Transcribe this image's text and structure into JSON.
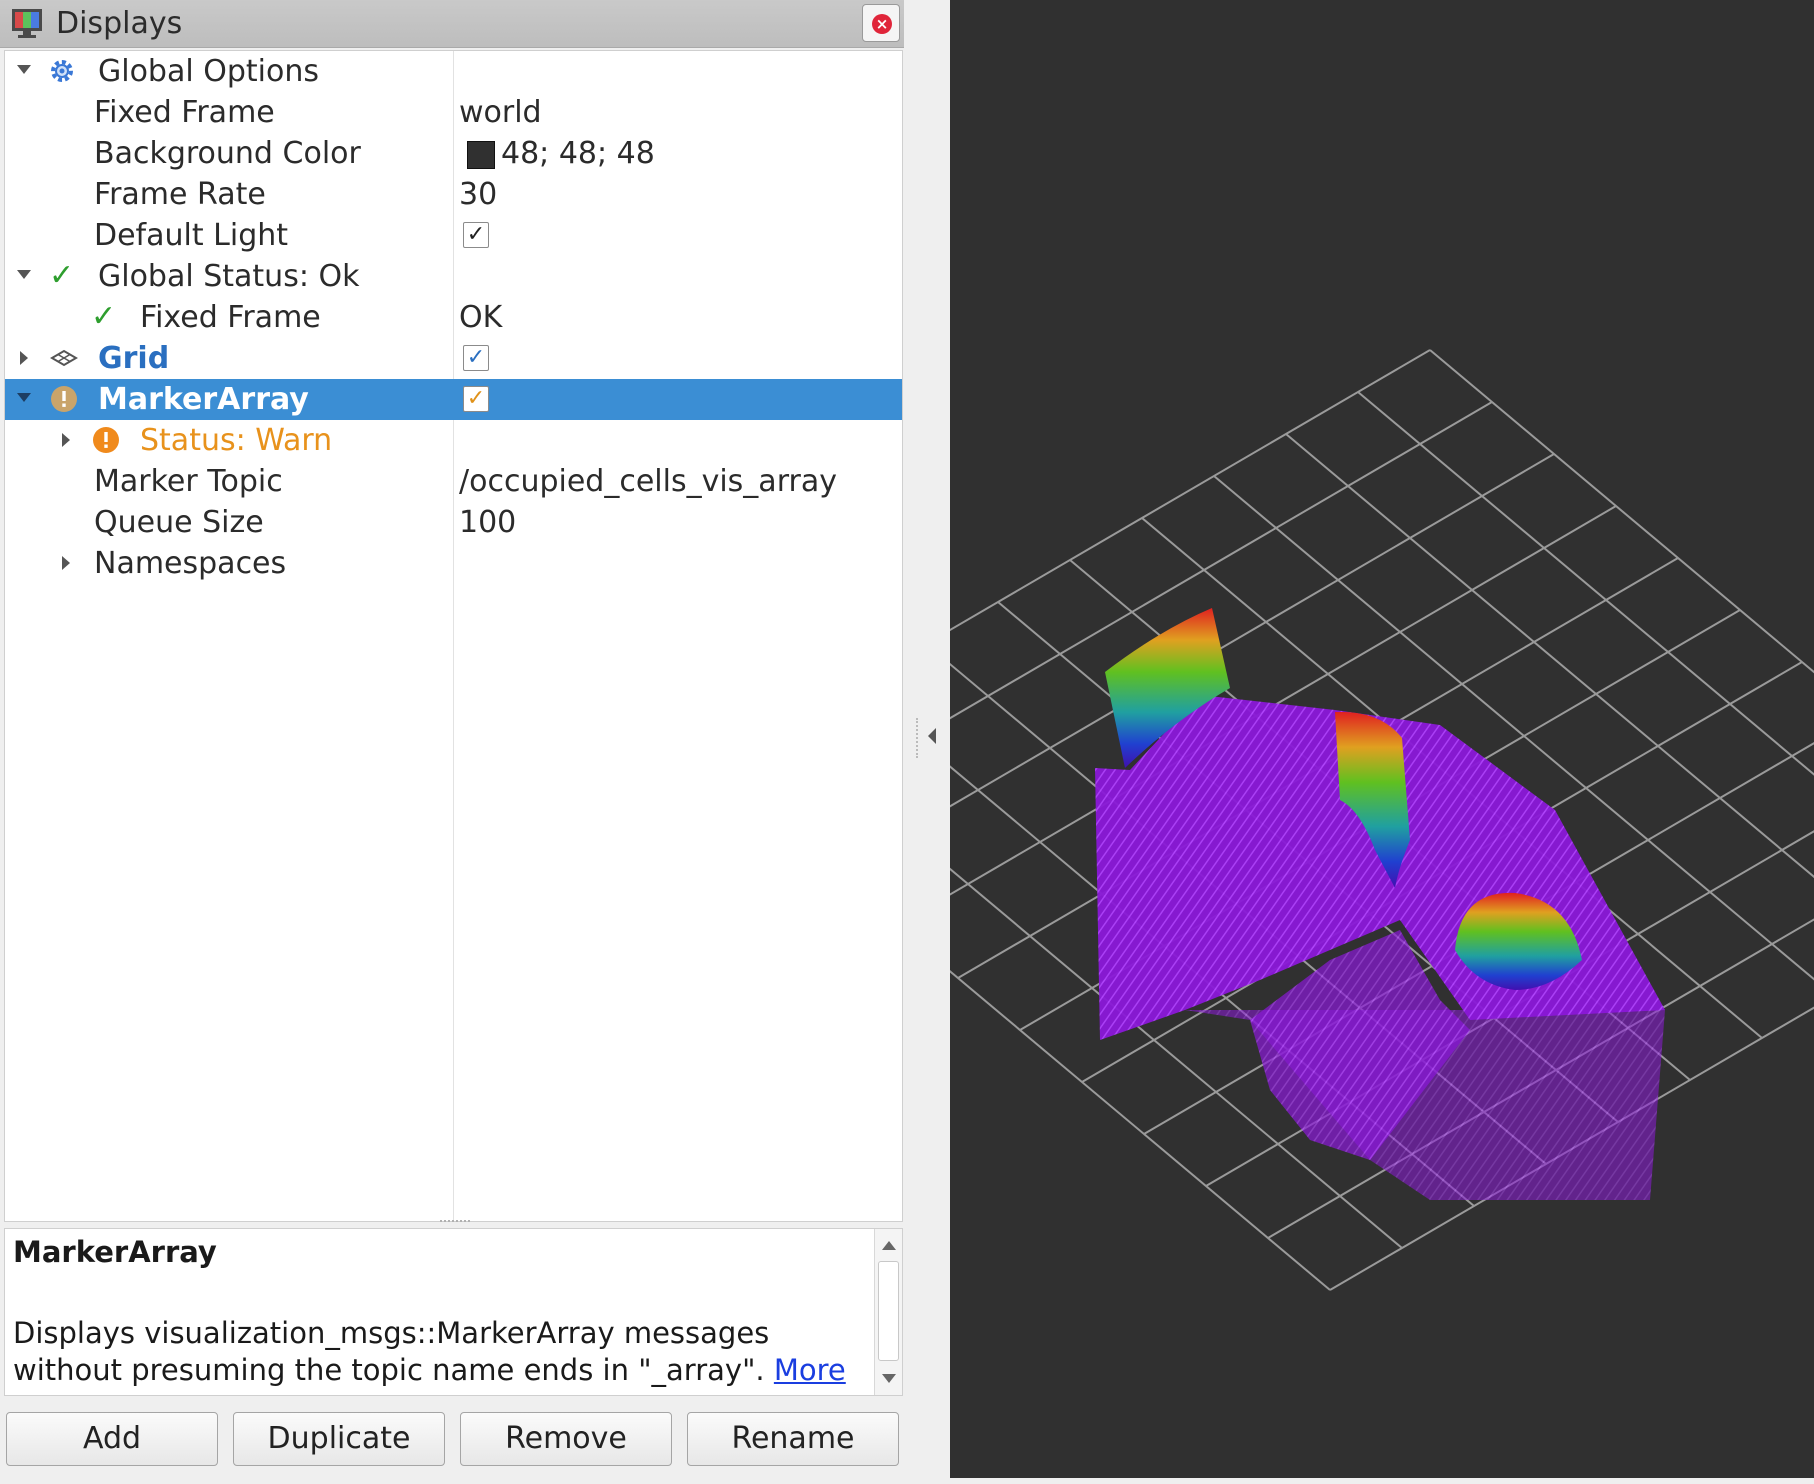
{
  "window": {
    "title": "Displays",
    "title_icon": "monitor-icon",
    "close_icon": "close-icon"
  },
  "tree": {
    "global_options": {
      "label": "Global Options",
      "icon": "gear-icon"
    },
    "fixed_frame": {
      "label": "Fixed Frame",
      "value": "world"
    },
    "background_color": {
      "label": "Background Color",
      "value": "48; 48; 48",
      "color": "#303030"
    },
    "frame_rate": {
      "label": "Frame Rate",
      "value": "30"
    },
    "default_light": {
      "label": "Default Light",
      "checked": "✓"
    },
    "global_status": {
      "label": "Global Status: Ok",
      "icon": "check-icon"
    },
    "status_fixed_frame": {
      "label": "Fixed Frame",
      "value": "OK",
      "icon": "check-icon"
    },
    "grid": {
      "label": "Grid",
      "checked": "✓",
      "icon": "grid-icon"
    },
    "marker_array": {
      "label": "MarkerArray",
      "checked": "✓",
      "icon": "warning-icon"
    },
    "status_warn": {
      "label": "Status: Warn",
      "icon": "warning-icon"
    },
    "marker_topic": {
      "label": "Marker Topic",
      "value": "/occupied_cells_vis_array"
    },
    "queue_size": {
      "label": "Queue Size",
      "value": "100"
    },
    "namespaces": {
      "label": "Namespaces"
    }
  },
  "description": {
    "title": "MarkerArray",
    "body": "Displays visualization_msgs::MarkerArray messages without presuming the topic name ends in \"_array\". ",
    "more_link": "More"
  },
  "buttons": {
    "add": "Add",
    "duplicate": "Duplicate",
    "remove": "Remove",
    "rename": "Rename"
  },
  "colors": {
    "selection": "#3b8ed4",
    "view_background": "#303030",
    "grid_lines": "#a0a0a0",
    "marker_floor": "#9b1ff0",
    "warn": "#e8921c"
  }
}
